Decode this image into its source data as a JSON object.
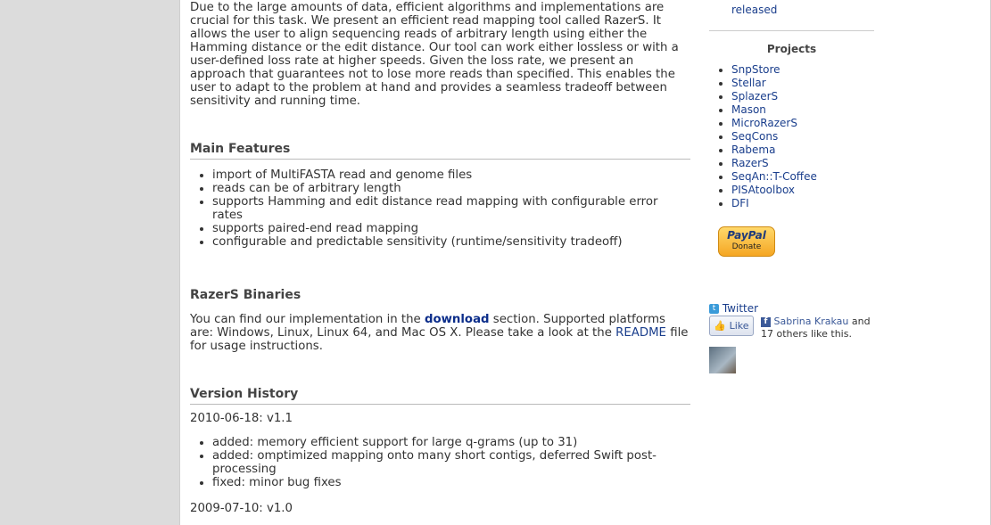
{
  "main": {
    "intro": "Due to the large amounts of data, efficient algorithms and implementations are crucial for this task. We present an efficient read mapping tool called RazerS. It allows the user to align sequencing reads of arbitrary length using either the Hamming distance or the edit distance. Our tool can work either lossless or with a user-defined loss rate at higher speeds. Given the loss rate, we present an approach that guarantees not to lose more reads than specified. This enables the user to adapt to the problem at hand and provides a seamless tradeoff between sensitivity and running time.",
    "features": {
      "heading": "Main Features",
      "items": [
        "import of MultiFASTA read and genome files",
        "reads can be of arbitrary length",
        "supports Hamming and edit distance read mapping with configurable error rates",
        "supports paired-end read mapping",
        "configurable and predictable sensitivity (runtime/sensitivity tradeoff)"
      ]
    },
    "binaries": {
      "heading": "RazerS Binaries",
      "text_before": "You can find our implementation in the ",
      "download_link": "download",
      "text_middle": " section. Supported platforms are: Windows, Linux, Linux 64, and Mac OS X. Please take a look at the ",
      "readme_link": "README",
      "text_after": " file for usage instructions."
    },
    "history": {
      "heading": "Version History",
      "v11_date": "2010-06-18: v1.1",
      "v11_items": [
        "added: memory efficient support for large q-grams (up to 31)",
        "added: omptimized mapping onto many short contigs, deferred Swift post-processing",
        "fixed: minor bug fixes"
      ],
      "v10_date": "2009-07-10: v1.0"
    }
  },
  "sidebar": {
    "released": "released",
    "projects_title": "Projects",
    "projects": [
      "SnpStore",
      "Stellar",
      "SplazerS",
      "Mason",
      "MicroRazerS",
      "SeqCons",
      "Rabema",
      "RazerS",
      "SeqAn::T-Coffee",
      "PISAtoolbox",
      "DFI"
    ],
    "paypal_label": "PayPal",
    "paypal_sub": "Donate",
    "twitter_label": "Twitter",
    "like_label": "Like",
    "fb_name": "Sabrina Krakau",
    "fb_text_1": " and",
    "fb_text_2": "17 others like this."
  }
}
